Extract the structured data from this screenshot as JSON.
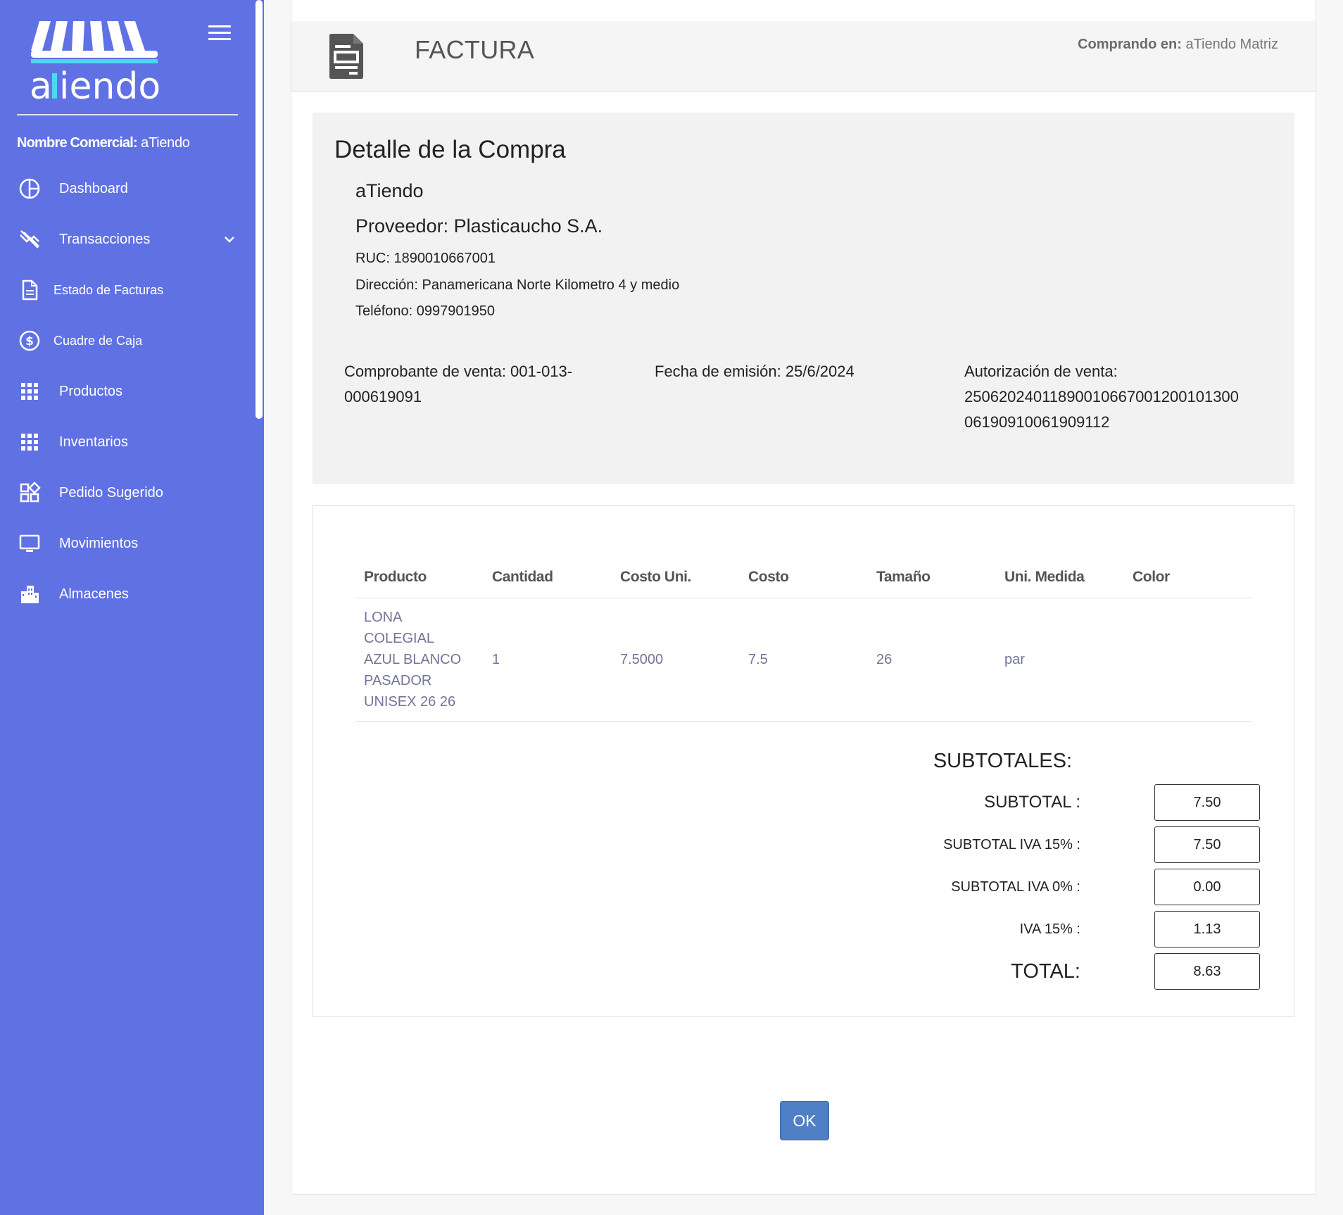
{
  "sidebar": {
    "logo_text": "aTiendo",
    "nombre_label": "Nombre Comercial:",
    "nombre_value": "aTiendo",
    "items": [
      {
        "label": "Dashboard",
        "icon": "chart-pie-icon"
      },
      {
        "label": "Transacciones",
        "icon": "transfer-off-icon"
      },
      {
        "label": "Estado de Facturas",
        "icon": "document-icon"
      },
      {
        "label": "Cuadre de Caja",
        "icon": "dollar-circle-icon"
      },
      {
        "label": "Productos",
        "icon": "grid-icon"
      },
      {
        "label": "Inventarios",
        "icon": "grid-icon"
      },
      {
        "label": "Pedido Sugerido",
        "icon": "widgets-icon"
      },
      {
        "label": "Movimientos",
        "icon": "monitor-icon"
      },
      {
        "label": "Almacenes",
        "icon": "buildings-icon"
      }
    ]
  },
  "header": {
    "title": "FACTURA",
    "comprando_label": "Comprando en:",
    "comprando_value": "aTiendo Matriz"
  },
  "detail": {
    "title": "Detalle de la Compra",
    "store": "aTiendo",
    "proveedor": "Proveedor: Plasticaucho S.A.",
    "ruc": "RUC: 1890010667001",
    "direccion": "Dirección: Panamericana Norte Kilometro 4 y medio",
    "telefono": "Teléfono: 0997901950",
    "comprobante_1": "Comprobante de venta: 001-013-",
    "comprobante_2": "000619091",
    "fecha": "Fecha de emisión: 25/6/2024",
    "autorizacion_label": "Autorización de venta:",
    "autorizacion_1": "2506202401189001066700120010130​0",
    "autorizacion_2": "06190910061909112"
  },
  "table": {
    "headers": [
      "Producto",
      "Cantidad",
      "Costo Uni.",
      "Costo",
      "Tamaño",
      "Uni. Medida",
      "Color"
    ],
    "rows": [
      {
        "producto": "LONA COLEGIAL AZUL BLANCO PASADOR UNISEX 26 26",
        "cantidad": "1",
        "costo_uni": "7.5000",
        "costo": "7.5",
        "tamano": "26",
        "uni_medida": "par",
        "color": ""
      }
    ]
  },
  "subtotales": {
    "title": "SUBTOTALES:",
    "subtotal_label": "SUBTOTAL :",
    "subtotal_value": "7.50",
    "iva15_sub_label": "SUBTOTAL IVA 15% :",
    "iva15_sub_value": "7.50",
    "iva0_sub_label": "SUBTOTAL IVA 0% :",
    "iva0_sub_value": "0.00",
    "iva15_label": "IVA 15% :",
    "iva15_value": "1.13",
    "total_label": "TOTAL:",
    "total_value": "8.63"
  },
  "ok_label": "OK",
  "colors": {
    "sidebar": "#6071e4",
    "ok_button": "#4f7fc4",
    "logo_accent": "#4fd6f0"
  }
}
